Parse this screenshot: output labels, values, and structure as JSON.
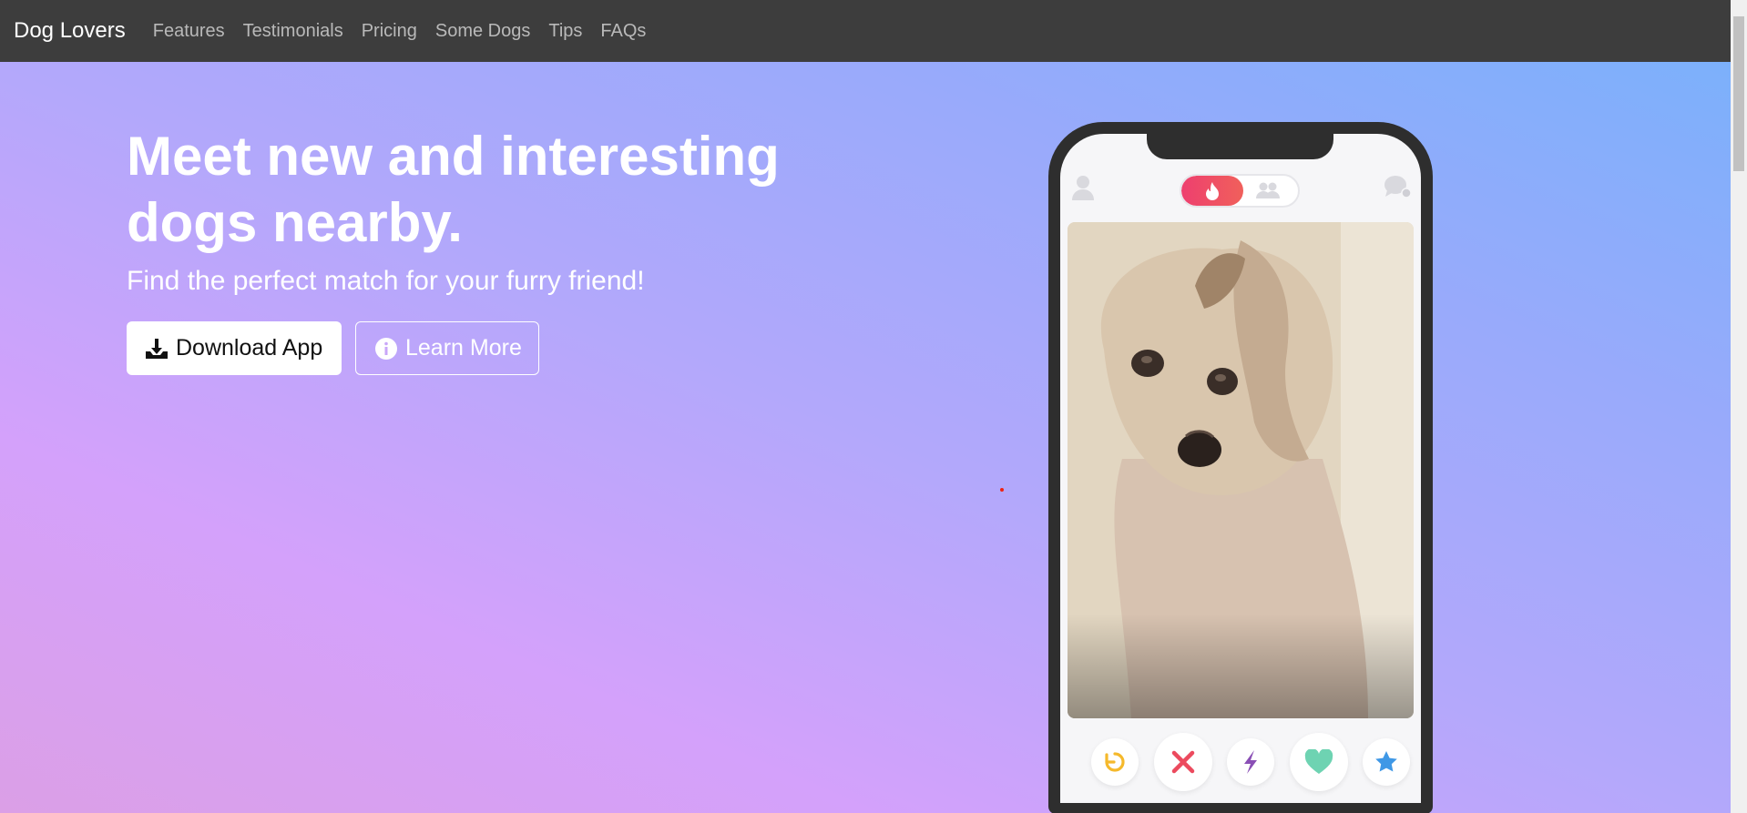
{
  "navbar": {
    "brand": "Dog Lovers",
    "links": [
      "Features",
      "Testimonials",
      "Pricing",
      "Some Dogs",
      "Tips",
      "FAQs"
    ]
  },
  "hero": {
    "headline": "Meet new and interesting dogs nearby.",
    "subheadline": "Find the perfect match for your furry friend!",
    "download_label": "Download App",
    "learn_label": "Learn More"
  },
  "phone": {
    "toggle_active": "flame-icon",
    "toggle_inactive": "group-icon",
    "actions": [
      "rewind-icon",
      "nope-icon",
      "boost-icon",
      "like-icon",
      "superlike-icon"
    ]
  },
  "colors": {
    "navbar_bg": "#3d3d3d",
    "gradient_start": "#db9fe6",
    "gradient_end": "#7cb0fb",
    "rewind": "#f5b92c",
    "nope": "#ec4a5e",
    "boost": "#8a4fb5",
    "like": "#6ed3b2",
    "superlike": "#3f98e6"
  }
}
